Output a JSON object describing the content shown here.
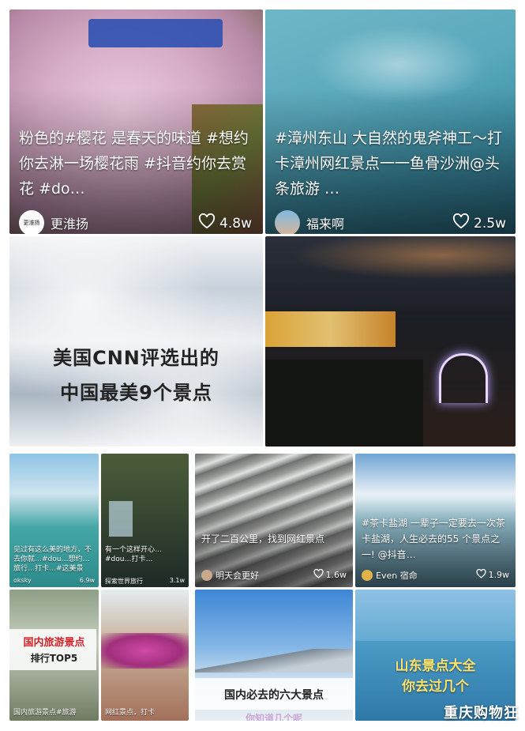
{
  "top_cards": [
    {
      "caption": "粉色的#樱花 是春天的味道 #想约你去淋一场樱花雨 #抖音约你去赏花 #do…",
      "author": "更淮扬",
      "avatar_text": "更淮扬",
      "likes": "4.8w",
      "icon": "heart-outline-icon"
    },
    {
      "caption": "#漳州东山 大自然的鬼斧神工～打卡漳州网红景点一一鱼骨沙洲@头条旅游 …",
      "author": "福来啊",
      "likes": "2.5w",
      "icon": "heart-outline-icon"
    }
  ],
  "middle_cards": [
    {
      "overlay_line1": "美国CNN评选出的",
      "overlay_line2": "中国最美9个景点"
    },
    {
      "overlay_line1": "",
      "overlay_line2": ""
    }
  ],
  "bottom_left": {
    "tiles": [
      {
        "caption": "见过有这么美的地方，不去你就…#dou…想约…旅行…打卡…#这美景",
        "meta": "oksky",
        "likes": "6.9w"
      },
      {
        "caption": "有一个这样开心…#dou…打卡…",
        "meta": "探索世界旅行",
        "likes": "3.1w"
      },
      {
        "overlay_title": "国内旅游景点",
        "overlay_sub": "排行TOP5",
        "caption": "国内旅游景点#旅游"
      },
      {
        "caption": "网红景点，打卡"
      }
    ]
  },
  "bottom_right": {
    "cards": [
      {
        "caption": "开了二百公里，找到网红景点",
        "author": "明天会更好",
        "likes": "1.6w"
      },
      {
        "caption": "#茶卡盐湖 一辈子一定要去一次茶卡盐湖，人生必去的55 个景点之一! @抖音…",
        "author": "Even  宿命",
        "likes": "1.9w"
      },
      {
        "overlay": "国内必去的六大景点",
        "overlay_sub": "你知道几个呢"
      },
      {
        "overlay_line1": "山东景点大全",
        "overlay_line2": "你去过几个"
      }
    ]
  },
  "watermark": "重庆购物狂",
  "colors": {
    "highlight_yellow": "#f5d000",
    "text_dark": "#222222"
  }
}
